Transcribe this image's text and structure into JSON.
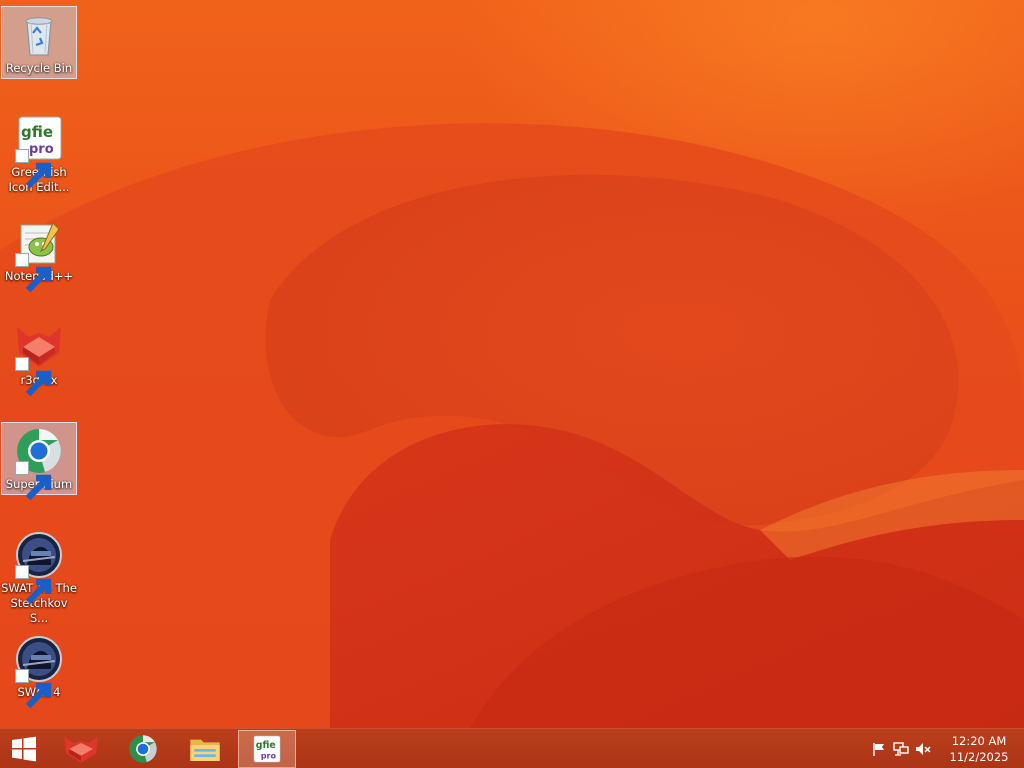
{
  "desktop": {
    "icons": [
      {
        "label": "Recycle Bin",
        "icon": "recycle-bin-icon",
        "shortcut": false,
        "selected": true
      },
      {
        "label": "Greenfish Icon Edit...",
        "icon": "greenfish-icon-editor-icon",
        "shortcut": true,
        "selected": false
      },
      {
        "label": "Notepad++",
        "icon": "notepad-plus-plus-icon",
        "shortcut": true,
        "selected": false
      },
      {
        "label": "r3dfox",
        "icon": "r3dfox-icon",
        "shortcut": true,
        "selected": false
      },
      {
        "label": "Supermium",
        "icon": "supermium-icon",
        "shortcut": true,
        "selected": true
      },
      {
        "label": "SWAT 4 - The Stetchkov S...",
        "icon": "swat4-stetchkov-icon",
        "shortcut": true,
        "selected": false
      },
      {
        "label": "SWAT 4",
        "icon": "swat4-icon",
        "shortcut": true,
        "selected": false
      }
    ]
  },
  "taskbar": {
    "start": {
      "icon": "windows-logo-icon"
    },
    "pinned": [
      {
        "name": "r3dfox",
        "icon": "r3dfox-icon",
        "active": false
      },
      {
        "name": "Supermium",
        "icon": "supermium-icon",
        "active": false
      },
      {
        "name": "File Explorer",
        "icon": "file-explorer-icon",
        "active": false
      },
      {
        "name": "Greenfish Icon Editor Pro",
        "icon": "greenfish-icon-editor-icon",
        "active": true
      }
    ],
    "tray": {
      "icons": [
        "action-center-flag-icon",
        "network-icon",
        "volume-muted-icon"
      ],
      "time": "12:20 AM",
      "date": "11/2/2025"
    }
  },
  "colors": {
    "wallpaper": "#e8501c",
    "taskbar": "#b53b1a",
    "selection": "#bed2eb"
  }
}
